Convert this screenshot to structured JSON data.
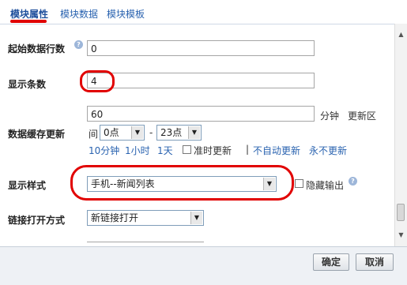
{
  "tabs": [
    {
      "label": "模块属性",
      "active": true
    },
    {
      "label": "模块数据",
      "active": false
    },
    {
      "label": "模块模板",
      "active": false
    }
  ],
  "fields": {
    "start_row": {
      "label": "起始数据行数",
      "value": "0"
    },
    "display_count": {
      "label": "显示条数",
      "value": "4"
    },
    "cache_update": {
      "label": "数据缓存更新",
      "value": "60",
      "unit": "分钟",
      "update_area_link": "更新区",
      "interval_label": "间",
      "from_hour": "0点",
      "dash": "-",
      "to_hour": "23点",
      "quick_links": [
        "10分钟",
        "1小时",
        "1天"
      ],
      "ontime_label": "准时更新",
      "separator": "|",
      "no_auto_update": "不自动更新",
      "never_update": "永不更新"
    },
    "display_style": {
      "label": "显示样式",
      "value": "手机--新闻列表",
      "hide_output_label": "隐藏输出"
    },
    "link_open": {
      "label": "链接打开方式",
      "value": "新链接打开"
    }
  },
  "footer": {
    "ok_label": "确定",
    "cancel_label": "取消"
  },
  "colors": {
    "annotation": "#e10000",
    "link": "#2a63b0",
    "help_icon": "#9db6d9"
  },
  "icons": {
    "help": "question-mark-icon",
    "dropdown": "triangle-down-icon"
  }
}
